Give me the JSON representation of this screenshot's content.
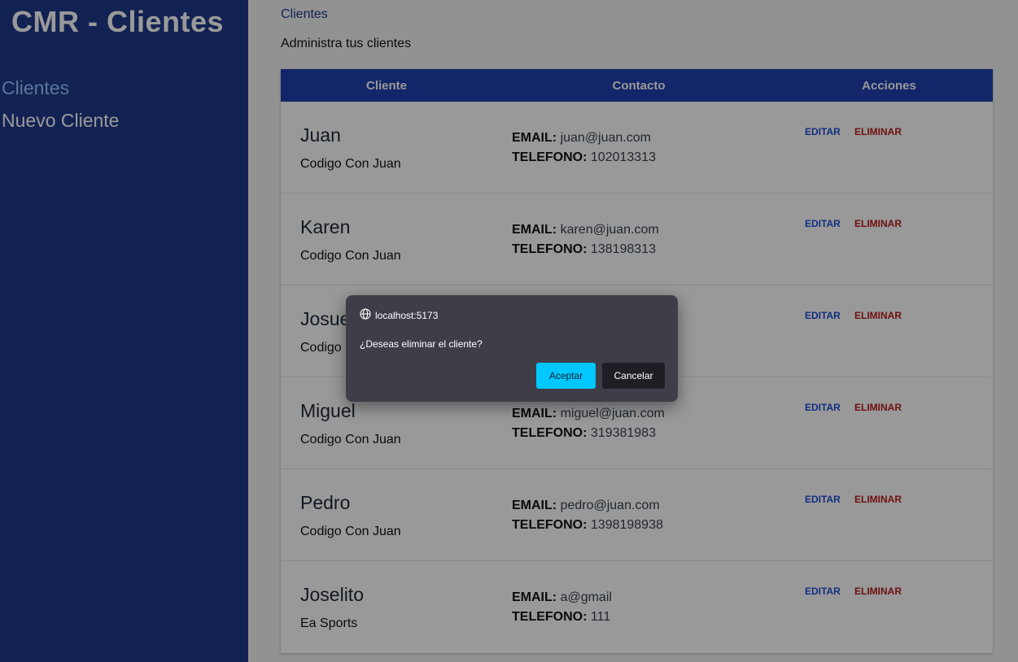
{
  "sidebar": {
    "title": "CMR - Clientes",
    "nav": [
      {
        "label": "Clientes",
        "active": true
      },
      {
        "label": "Nuevo Cliente",
        "active": false
      }
    ]
  },
  "main": {
    "breadcrumb": "Clientes",
    "subtitle": "Administra tus clientes",
    "table": {
      "headers": [
        "Cliente",
        "Contacto",
        "Acciones"
      ],
      "email_label": "EMAIL:",
      "phone_label": "TELEFONO:",
      "edit_label": "EDITAR",
      "delete_label": "ELIMINAR",
      "rows": [
        {
          "name": "Juan",
          "company": "Codigo Con Juan",
          "email": "juan@juan.com",
          "phone": "102013313"
        },
        {
          "name": "Karen",
          "company": "Codigo Con Juan",
          "email": "karen@juan.com",
          "phone": "138198313"
        },
        {
          "name": "Josue",
          "company": "Codigo",
          "email": "",
          "phone": ""
        },
        {
          "name": "Miguel",
          "company": "Codigo Con Juan",
          "email": "miguel@juan.com",
          "phone": "319381983"
        },
        {
          "name": "Pedro",
          "company": "Codigo Con Juan",
          "email": "pedro@juan.com",
          "phone": "1398198938"
        },
        {
          "name": "Joselito",
          "company": "Ea Sports",
          "email": "a@gmail",
          "phone": "111"
        }
      ]
    }
  },
  "dialog": {
    "origin": "localhost:5173",
    "origin_icon": "globe-icon",
    "message": "¿Deseas eliminar el cliente?",
    "ok_label": "Aceptar",
    "cancel_label": "Cancelar"
  },
  "colors": {
    "sidebar_bg": "#1e3a8a",
    "table_header_bg": "#1e40af",
    "edit": "#1d4ed8",
    "delete": "#b91c1c",
    "dialog_bg": "#3f3d48",
    "ok_button": "#00c8ff"
  }
}
